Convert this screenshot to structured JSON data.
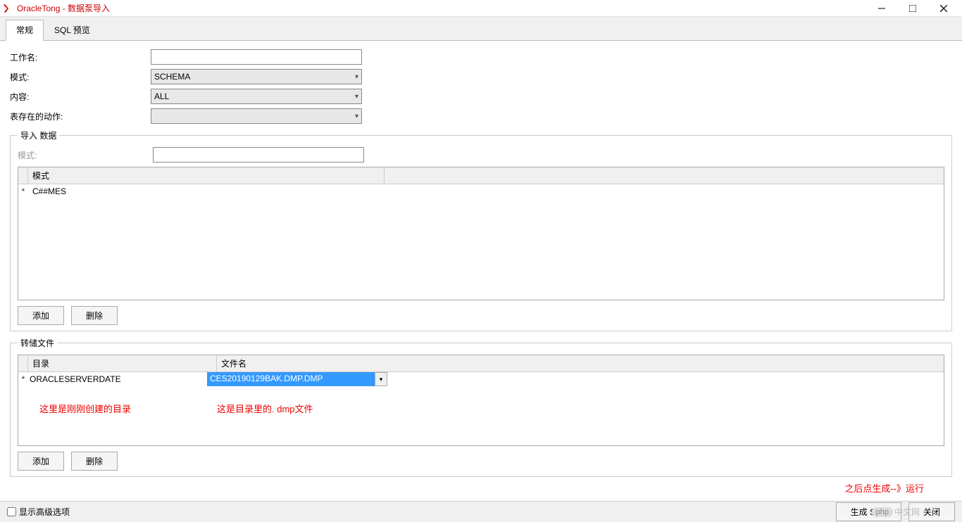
{
  "title": "OracleTong - 数据泵导入",
  "tabs": {
    "general": "常规",
    "sql_preview": "SQL 预览"
  },
  "form": {
    "job_name_label": "工作名:",
    "job_name_value": "",
    "mode_label": "模式:",
    "mode_value": "SCHEMA",
    "content_label": "内容:",
    "content_value": "ALL",
    "table_exists_label": "表存在的动作:",
    "table_exists_value": ""
  },
  "import_data": {
    "legend": "导入 数据",
    "schema_label": "模式:",
    "schema_value": "",
    "table_header": "模式",
    "row_marker": "*",
    "row_value": "C##MES",
    "add_btn": "添加",
    "delete_btn": "删除"
  },
  "dump_files": {
    "legend": "转储文件",
    "col_dir": "目录",
    "col_file": "文件名",
    "row_marker": "*",
    "dir_value": "ORACLESERVERDATE",
    "file_value": "CES20190129BAK.DMP.DMP",
    "add_btn": "添加",
    "delete_btn": "删除",
    "annotation_dir": "这里是刚刚创建的目录",
    "annotation_file": "这是目录里的. dmp文件"
  },
  "annotation_bottom": "之后点生成--》运行",
  "footer": {
    "advanced_checkbox": "显示高级选项",
    "generate_sql": "生成 SQL",
    "close": "关闭"
  },
  "watermark": {
    "badge": "php",
    "text": "中文网"
  }
}
